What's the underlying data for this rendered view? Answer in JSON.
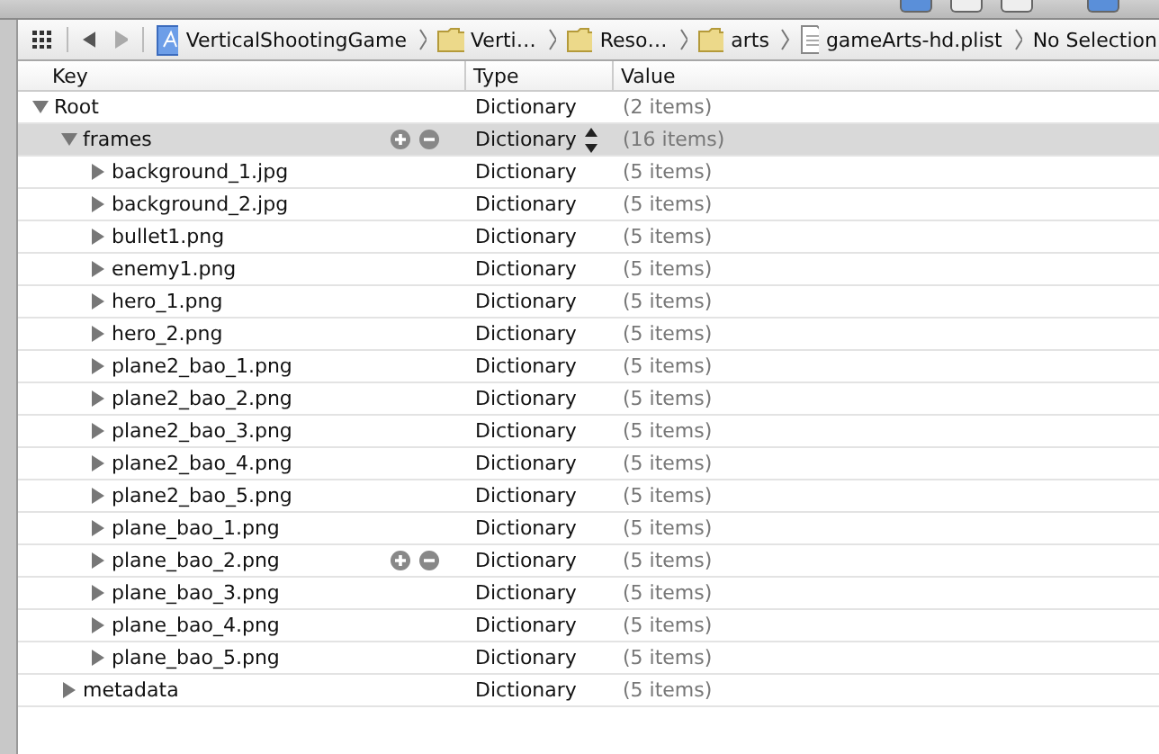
{
  "jump_bar": {
    "items": [
      {
        "kind": "project",
        "label": "VerticalShootingGame"
      },
      {
        "kind": "folder",
        "label": "Verti…"
      },
      {
        "kind": "folder",
        "label": "Reso…"
      },
      {
        "kind": "folder",
        "label": "arts"
      },
      {
        "kind": "file",
        "label": "gameArts-hd.plist"
      },
      {
        "kind": "text",
        "label": "No Selection"
      }
    ]
  },
  "table": {
    "columns": [
      "Key",
      "Type",
      "Value"
    ],
    "rows": [
      {
        "key": "Root",
        "type": "Dictionary",
        "value": "(2 items)",
        "expanded": true,
        "selected": false,
        "hovered": false,
        "children": [
          {
            "key": "frames",
            "type": "Dictionary",
            "value": "(16 items)",
            "expanded": true,
            "selected": true,
            "hovered": true,
            "children": [
              {
                "key": "background_1.jpg",
                "type": "Dictionary",
                "value": "(5 items)",
                "expanded": false,
                "selected": false,
                "hovered": false
              },
              {
                "key": "background_2.jpg",
                "type": "Dictionary",
                "value": "(5 items)",
                "expanded": false,
                "selected": false,
                "hovered": false
              },
              {
                "key": "bullet1.png",
                "type": "Dictionary",
                "value": "(5 items)",
                "expanded": false,
                "selected": false,
                "hovered": false
              },
              {
                "key": "enemy1.png",
                "type": "Dictionary",
                "value": "(5 items)",
                "expanded": false,
                "selected": false,
                "hovered": false
              },
              {
                "key": "hero_1.png",
                "type": "Dictionary",
                "value": "(5 items)",
                "expanded": false,
                "selected": false,
                "hovered": false
              },
              {
                "key": "hero_2.png",
                "type": "Dictionary",
                "value": "(5 items)",
                "expanded": false,
                "selected": false,
                "hovered": false
              },
              {
                "key": "plane2_bao_1.png",
                "type": "Dictionary",
                "value": "(5 items)",
                "expanded": false,
                "selected": false,
                "hovered": false
              },
              {
                "key": "plane2_bao_2.png",
                "type": "Dictionary",
                "value": "(5 items)",
                "expanded": false,
                "selected": false,
                "hovered": false
              },
              {
                "key": "plane2_bao_3.png",
                "type": "Dictionary",
                "value": "(5 items)",
                "expanded": false,
                "selected": false,
                "hovered": false
              },
              {
                "key": "plane2_bao_4.png",
                "type": "Dictionary",
                "value": "(5 items)",
                "expanded": false,
                "selected": false,
                "hovered": false
              },
              {
                "key": "plane2_bao_5.png",
                "type": "Dictionary",
                "value": "(5 items)",
                "expanded": false,
                "selected": false,
                "hovered": false
              },
              {
                "key": "plane_bao_1.png",
                "type": "Dictionary",
                "value": "(5 items)",
                "expanded": false,
                "selected": false,
                "hovered": false
              },
              {
                "key": "plane_bao_2.png",
                "type": "Dictionary",
                "value": "(5 items)",
                "expanded": false,
                "selected": false,
                "hovered": true
              },
              {
                "key": "plane_bao_3.png",
                "type": "Dictionary",
                "value": "(5 items)",
                "expanded": false,
                "selected": false,
                "hovered": false
              },
              {
                "key": "plane_bao_4.png",
                "type": "Dictionary",
                "value": "(5 items)",
                "expanded": false,
                "selected": false,
                "hovered": false
              },
              {
                "key": "plane_bao_5.png",
                "type": "Dictionary",
                "value": "(5 items)",
                "expanded": false,
                "selected": false,
                "hovered": false
              }
            ]
          },
          {
            "key": "metadata",
            "type": "Dictionary",
            "value": "(5 items)",
            "expanded": false,
            "selected": false,
            "hovered": false
          }
        ]
      }
    ]
  }
}
